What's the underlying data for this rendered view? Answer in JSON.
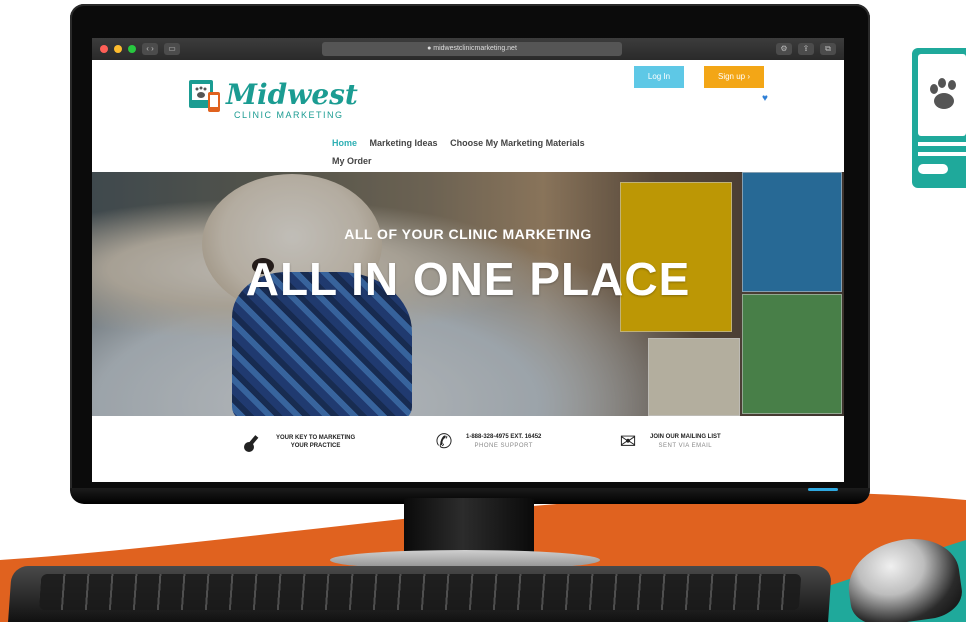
{
  "browser": {
    "url": "● midwestclinicmarketing.net",
    "traffic_lights": [
      "#ff5f57",
      "#febc2e",
      "#28c840"
    ]
  },
  "header": {
    "logo_title": "Midwest",
    "logo_subtitle": "CLINIC MARKETING",
    "login_label": "Log In",
    "signup_label": "Sign up  ›",
    "nav": [
      {
        "label": "Home",
        "active": true
      },
      {
        "label": "Marketing Ideas",
        "active": false
      },
      {
        "label": "Choose My Marketing Materials",
        "active": false
      },
      {
        "label": "My Order",
        "active": false
      }
    ]
  },
  "hero": {
    "subtitle": "ALL OF YOUR CLINIC MARKETING",
    "title": "ALL IN ONE PLACE"
  },
  "info_bar": {
    "key": {
      "line1": "YOUR KEY TO MARKETING",
      "line2": "YOUR PRACTICE",
      "icon": "key-icon"
    },
    "phone": {
      "line1": "1-888-328-4975 EXT. 16452",
      "sub": "PHONE SUPPORT",
      "icon": "phone-icon"
    },
    "mail": {
      "line1": "JOIN OUR MAILING LIST",
      "sub": "SENT VIA EMAIL",
      "icon": "envelope-icon"
    }
  },
  "colors": {
    "brand_teal": "#1b9c92",
    "login_blue": "#5ec8e6",
    "signup_orange": "#f3a616",
    "swoosh_orange": "#e0621f"
  }
}
